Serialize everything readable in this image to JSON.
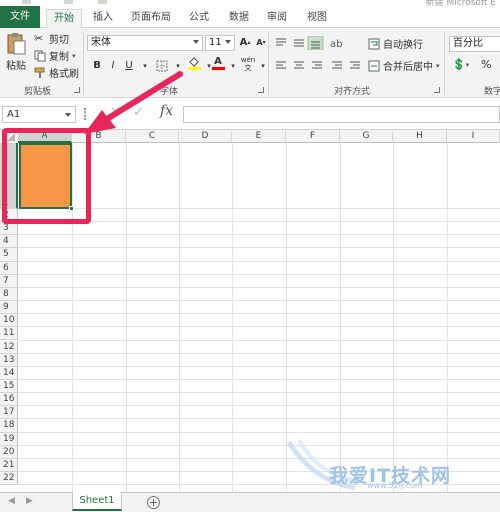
{
  "window": {
    "title": "新建 Microsoft E"
  },
  "tabs": [
    "文件",
    "开始",
    "插入",
    "页面布局",
    "公式",
    "数据",
    "审阅",
    "视图"
  ],
  "ribbon": {
    "paste": "粘贴",
    "cut": "剪切",
    "copy": "复制",
    "format_painter": "格式刷",
    "clipboard_label": "剪贴板",
    "font_name": "宋体",
    "font_size": "11",
    "grow_font": "A",
    "shrink_font": "A",
    "bold": "B",
    "italic": "I",
    "underline": "U",
    "font_color_letter": "A",
    "phonetic": "wén",
    "font_label": "字体",
    "wrap_text": "自动换行",
    "merge_center": "合并后居中",
    "alignment_label": "对齐方式",
    "number_format": "百分比",
    "number_label": "数字",
    "colors": {
      "fill_yellow": "#ffff00",
      "font_red": "#ff0000"
    }
  },
  "formula_bar": {
    "name_box": "A1",
    "fx": "fx",
    "value": ""
  },
  "grid": {
    "columns": [
      "A",
      "B",
      "C",
      "D",
      "E",
      "F",
      "G",
      "H",
      "I"
    ],
    "rows": [
      "1",
      "2",
      "3",
      "4",
      "5",
      "6",
      "7",
      "8",
      "9",
      "10",
      "11",
      "12",
      "13",
      "14",
      "15",
      "16",
      "17",
      "18",
      "19",
      "20",
      "21",
      "22"
    ],
    "selected_cell": "A1",
    "cell_fill_color": "#f79646",
    "accent": "#217346",
    "annotation_color": "#e8265a"
  },
  "sheets": {
    "active": "Sheet1",
    "add": "+"
  },
  "watermark": {
    "text": "我爱IT技术网",
    "url": "www.52ij.com"
  }
}
